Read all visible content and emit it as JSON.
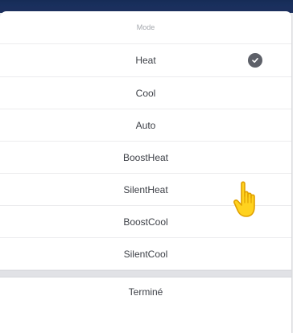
{
  "sheet": {
    "title": "Mode",
    "options": [
      {
        "label": "Heat",
        "selected": true
      },
      {
        "label": "Cool",
        "selected": false
      },
      {
        "label": "Auto",
        "selected": false
      },
      {
        "label": "BoostHeat",
        "selected": false
      },
      {
        "label": "SilentHeat",
        "selected": false
      },
      {
        "label": "BoostCool",
        "selected": false
      },
      {
        "label": "SilentCool",
        "selected": false
      }
    ],
    "done_label": "Terminé"
  },
  "icons": {
    "selected": "check-circle-icon",
    "pointer": "hand-pointer-icon"
  },
  "colors": {
    "header_bar": "#1c3466",
    "check": "#5d6068",
    "pointer_fill": "#ffd21f",
    "pointer_outline": "#e0a000"
  }
}
